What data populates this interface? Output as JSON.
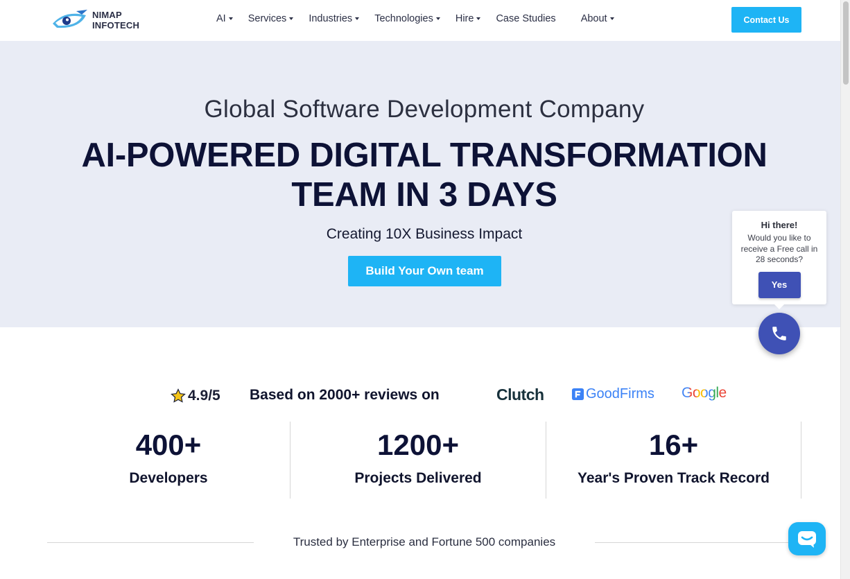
{
  "header": {
    "logo": {
      "line1": "NIMAP",
      "line2": "INFOTECH"
    },
    "nav": [
      {
        "label": "AI",
        "caret": true
      },
      {
        "label": "Services",
        "caret": true
      },
      {
        "label": "Industries",
        "caret": true
      },
      {
        "label": "Technologies",
        "caret": true
      },
      {
        "label": "Hire",
        "caret": true
      },
      {
        "label": "Case Studies",
        "caret": false
      },
      {
        "label": "About",
        "caret": true
      }
    ],
    "contact_label": "Contact Us"
  },
  "hero": {
    "subtitle": "Global Software Development Company",
    "title_line1": "AI-POWERED DIGITAL TRANSFORMATION",
    "title_line2": "TEAM IN 3 DAYS",
    "tagline": "Creating 10X Business Impact",
    "cta_label": "Build Your Own team"
  },
  "chat_popup": {
    "greeting": "Hi there!",
    "message": "Would you like to receive a Free call in 28 seconds?",
    "yes_label": "Yes"
  },
  "reviews": {
    "rating": "4.9/5",
    "based_on": "Based on 2000+ reviews on",
    "platforms": {
      "clutch": "Clutch",
      "goodfirms": "GoodFirms",
      "google": "Google"
    }
  },
  "stats": [
    {
      "value": "400+",
      "label": "Developers"
    },
    {
      "value": "1200+",
      "label": "Projects Delivered"
    },
    {
      "value": "16+",
      "label": "Year's Proven Track Record"
    }
  ],
  "trusted": "Trusted by Enterprise and Fortune 500 companies",
  "colors": {
    "accent": "#1eb4f5",
    "indigo": "#3f51b5",
    "hero_bg": "#e9ecf5",
    "heading": "#0d1236"
  }
}
